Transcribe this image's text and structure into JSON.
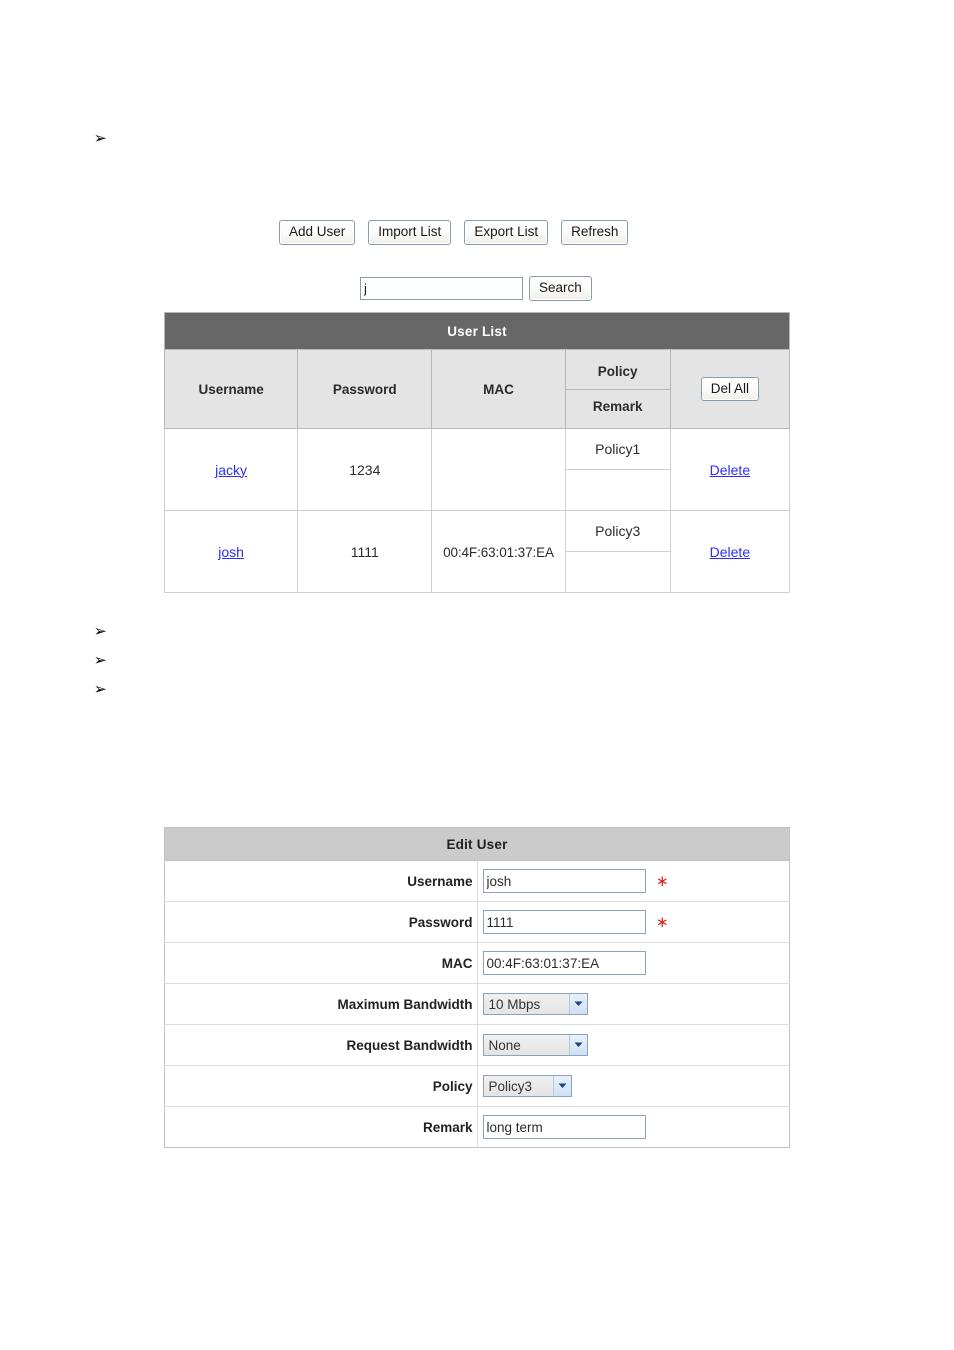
{
  "bullets": {
    "glyph": "➢",
    "items": [
      {
        "id": "bullet-1",
        "text": ""
      },
      {
        "id": "bullet-2",
        "text": ""
      },
      {
        "id": "bullet-3",
        "text": ""
      },
      {
        "id": "bullet-4",
        "text": ""
      }
    ]
  },
  "toolbar": {
    "add_user_label": "Add User",
    "import_list_label": "Import List",
    "export_list_label": "Export List",
    "refresh_label": "Refresh"
  },
  "search": {
    "value": "j",
    "placeholder": "",
    "button_label": "Search"
  },
  "user_list": {
    "title": "User List",
    "columns": {
      "username": "Username",
      "password": "Password",
      "mac": "MAC",
      "policy": "Policy",
      "remark": "Remark",
      "action": ""
    },
    "del_all_label": "Del All",
    "delete_label": "Delete",
    "rows": [
      {
        "username": "jacky",
        "password": "1234",
        "mac": "",
        "policy": "Policy1",
        "remark": "",
        "action": "Delete"
      },
      {
        "username": "josh",
        "password": "1111",
        "mac": "00:4F:63:01:37:EA",
        "policy": "Policy3",
        "remark": "",
        "action": "Delete"
      }
    ]
  },
  "edit_user": {
    "title": "Edit User",
    "fields": {
      "username": {
        "label": "Username",
        "value": "josh",
        "required_mark": "∗"
      },
      "password": {
        "label": "Password",
        "value": "1111",
        "required_mark": "∗"
      },
      "mac": {
        "label": "MAC",
        "value": "00:4F:63:01:37:EA"
      },
      "maximum_bandwidth": {
        "label": "Maximum Bandwidth",
        "value": "10 Mbps"
      },
      "request_bandwidth": {
        "label": "Request Bandwidth",
        "value": "None"
      },
      "policy": {
        "label": "Policy",
        "value": "Policy3"
      },
      "remark": {
        "label": "Remark",
        "value": "long term"
      }
    }
  },
  "colors": {
    "user_list_header_bg": "#676767",
    "table_head_bg": "#e4e4e4",
    "edit_header_bg": "#cbcbcb",
    "link": "#2e2ef0",
    "required": "#e02020",
    "border": "#b8b8b8"
  }
}
